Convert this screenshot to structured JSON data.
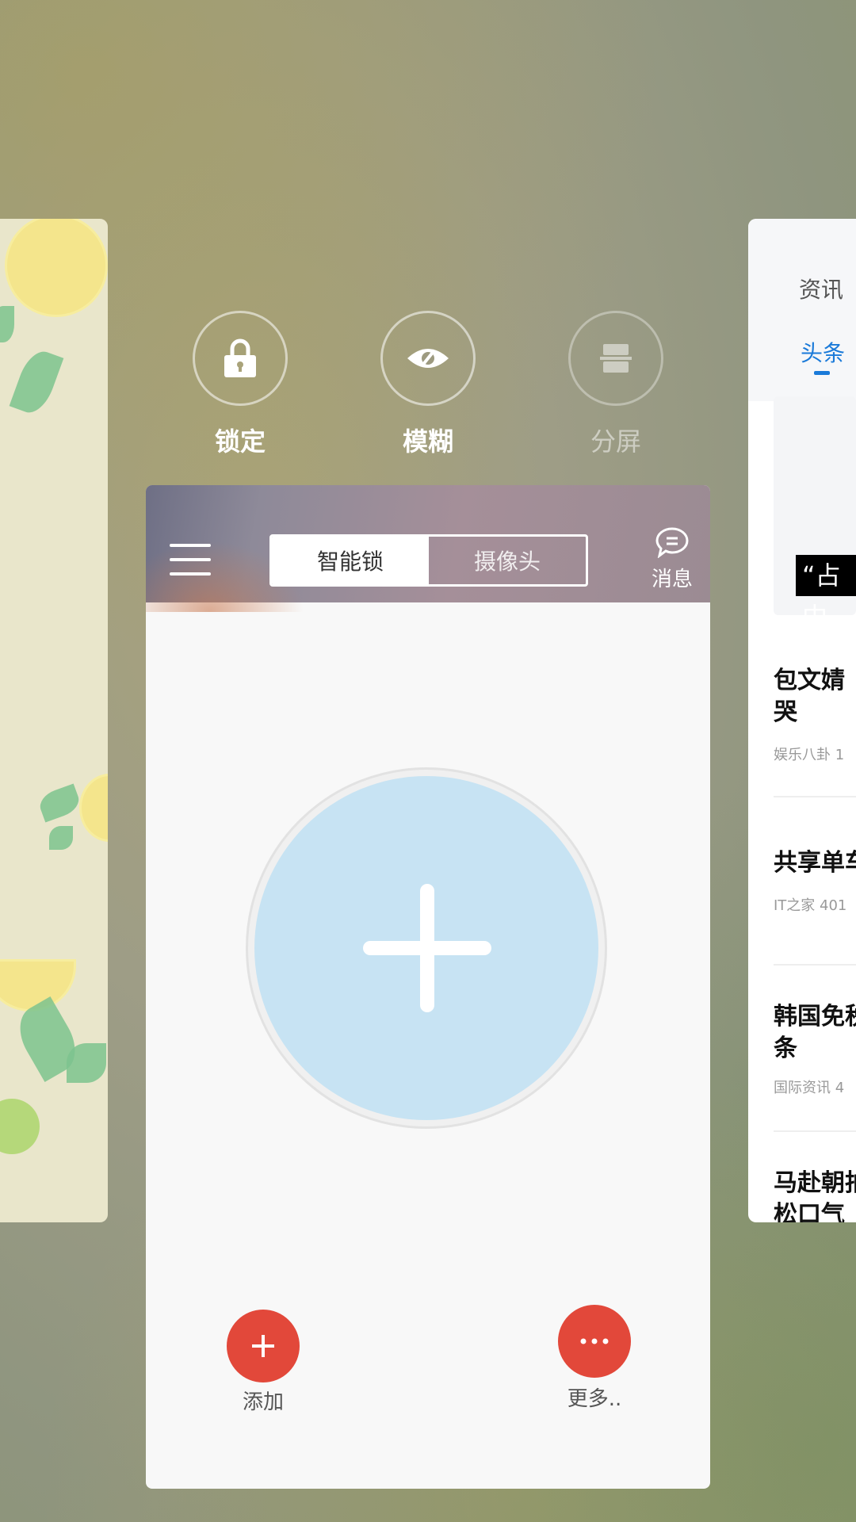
{
  "background": {
    "accent": "#9e9d86"
  },
  "left_card": {
    "app": "theme-wallpaper"
  },
  "quick_actions": [
    {
      "label": "锁定",
      "icon": "lock-icon",
      "enabled": true
    },
    {
      "label": "模糊",
      "icon": "eye-icon",
      "enabled": true
    },
    {
      "label": "分屏",
      "icon": "split-screen-icon",
      "enabled": false
    }
  ],
  "app_card": {
    "tabs": [
      "智能锁",
      "摄像头"
    ],
    "active_tab": 0,
    "message_label": "消息",
    "add_label": "添加",
    "more_label": "更多..",
    "fab_color": "#e2483a",
    "add_circle_color": "#c7e3f3"
  },
  "right_card": {
    "section_title": "资讯",
    "active_tab": "头条",
    "banner_tag": "“占中",
    "news": [
      {
        "title": "包文婧",
        "title2": "哭",
        "meta": "娱乐八卦  1"
      },
      {
        "title": "共享单车",
        "title2": "",
        "meta": "IT之家  401"
      },
      {
        "title": "韩国免税",
        "title2": "条",
        "meta": "国际资讯  4"
      },
      {
        "title": "马赴朝拍",
        "title2": "松口气",
        "meta": ""
      }
    ],
    "accent": "#1a7ad9"
  }
}
